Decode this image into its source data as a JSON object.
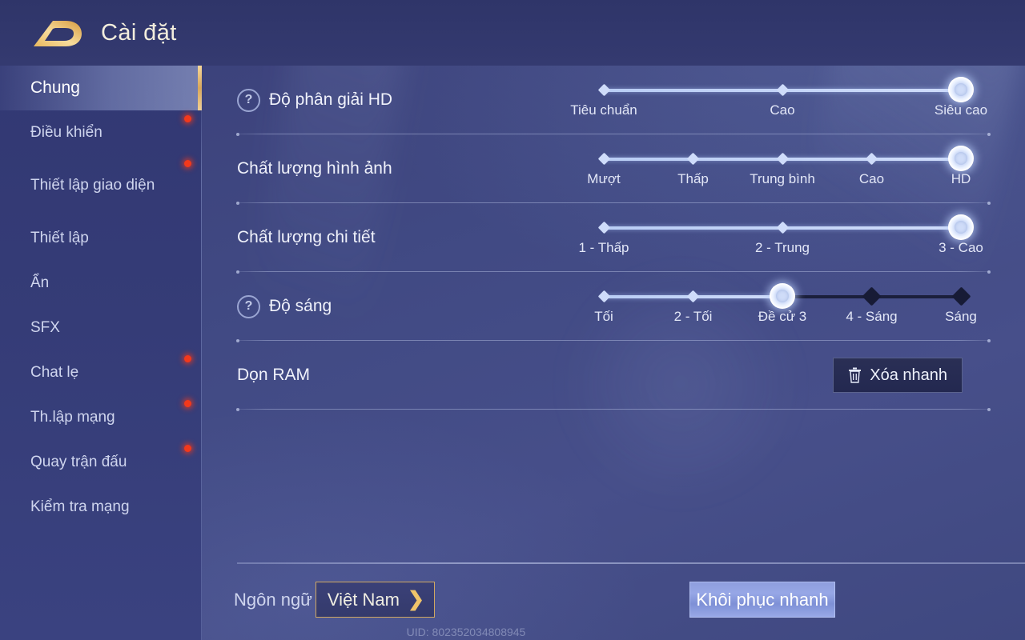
{
  "header": {
    "title": "Cài đặt",
    "logo_icon": "game-logo-icon"
  },
  "sidebar": {
    "items": [
      {
        "label": "Chung",
        "active": true,
        "dot": false
      },
      {
        "label": "Điều khiển",
        "active": false,
        "dot": true
      },
      {
        "label": "Thiết lập giao diện",
        "active": false,
        "dot": true
      },
      {
        "label": "Thiết lập",
        "active": false,
        "dot": false
      },
      {
        "label": "Ẩn",
        "active": false,
        "dot": false
      },
      {
        "label": "SFX",
        "active": false,
        "dot": false
      },
      {
        "label": "Chat lẹ",
        "active": false,
        "dot": true
      },
      {
        "label": "Th.lập mạng",
        "active": false,
        "dot": true
      },
      {
        "label": "Quay trận đấu",
        "active": false,
        "dot": true
      },
      {
        "label": "Kiểm tra mạng",
        "active": false,
        "dot": false
      }
    ]
  },
  "settings": {
    "rows": [
      {
        "label": "Độ phân giải HD",
        "help": true,
        "type": "slider",
        "ticks": [
          "Tiêu chuẩn",
          "Cao",
          "Siêu cao"
        ],
        "value_index": 2
      },
      {
        "label": "Chất lượng hình ảnh",
        "help": false,
        "type": "slider",
        "ticks": [
          "Mượt",
          "Thấp",
          "Trung bình",
          "Cao",
          "HD"
        ],
        "value_index": 4
      },
      {
        "label": "Chất lượng chi tiết",
        "help": false,
        "type": "slider",
        "ticks": [
          "1 - Thấp",
          "2 - Trung",
          "3 - Cao"
        ],
        "value_index": 2
      },
      {
        "label": "Độ sáng",
        "help": true,
        "type": "slider",
        "ticks": [
          "Tối",
          "2 - Tối",
          "Đề cử 3",
          "4 - Sáng",
          "Sáng"
        ],
        "value_index": 2
      },
      {
        "label": "Dọn RAM",
        "help": false,
        "type": "button",
        "button_label": "Xóa nhanh",
        "button_icon": "trash-icon"
      }
    ]
  },
  "bottom": {
    "language_label": "Ngôn ngữ",
    "language_value": "Việt Nam",
    "chevron_icon": "chevron-right-icon",
    "restore_label": "Khôi phục nhanh",
    "uid": "UID: 802352034808945"
  },
  "colors": {
    "accent_gold": "#d0a862",
    "slider_fill": "#cfdcfa",
    "slider_empty": "#1b1f3c",
    "badge_red": "#f2391c",
    "background": "#414a84"
  }
}
